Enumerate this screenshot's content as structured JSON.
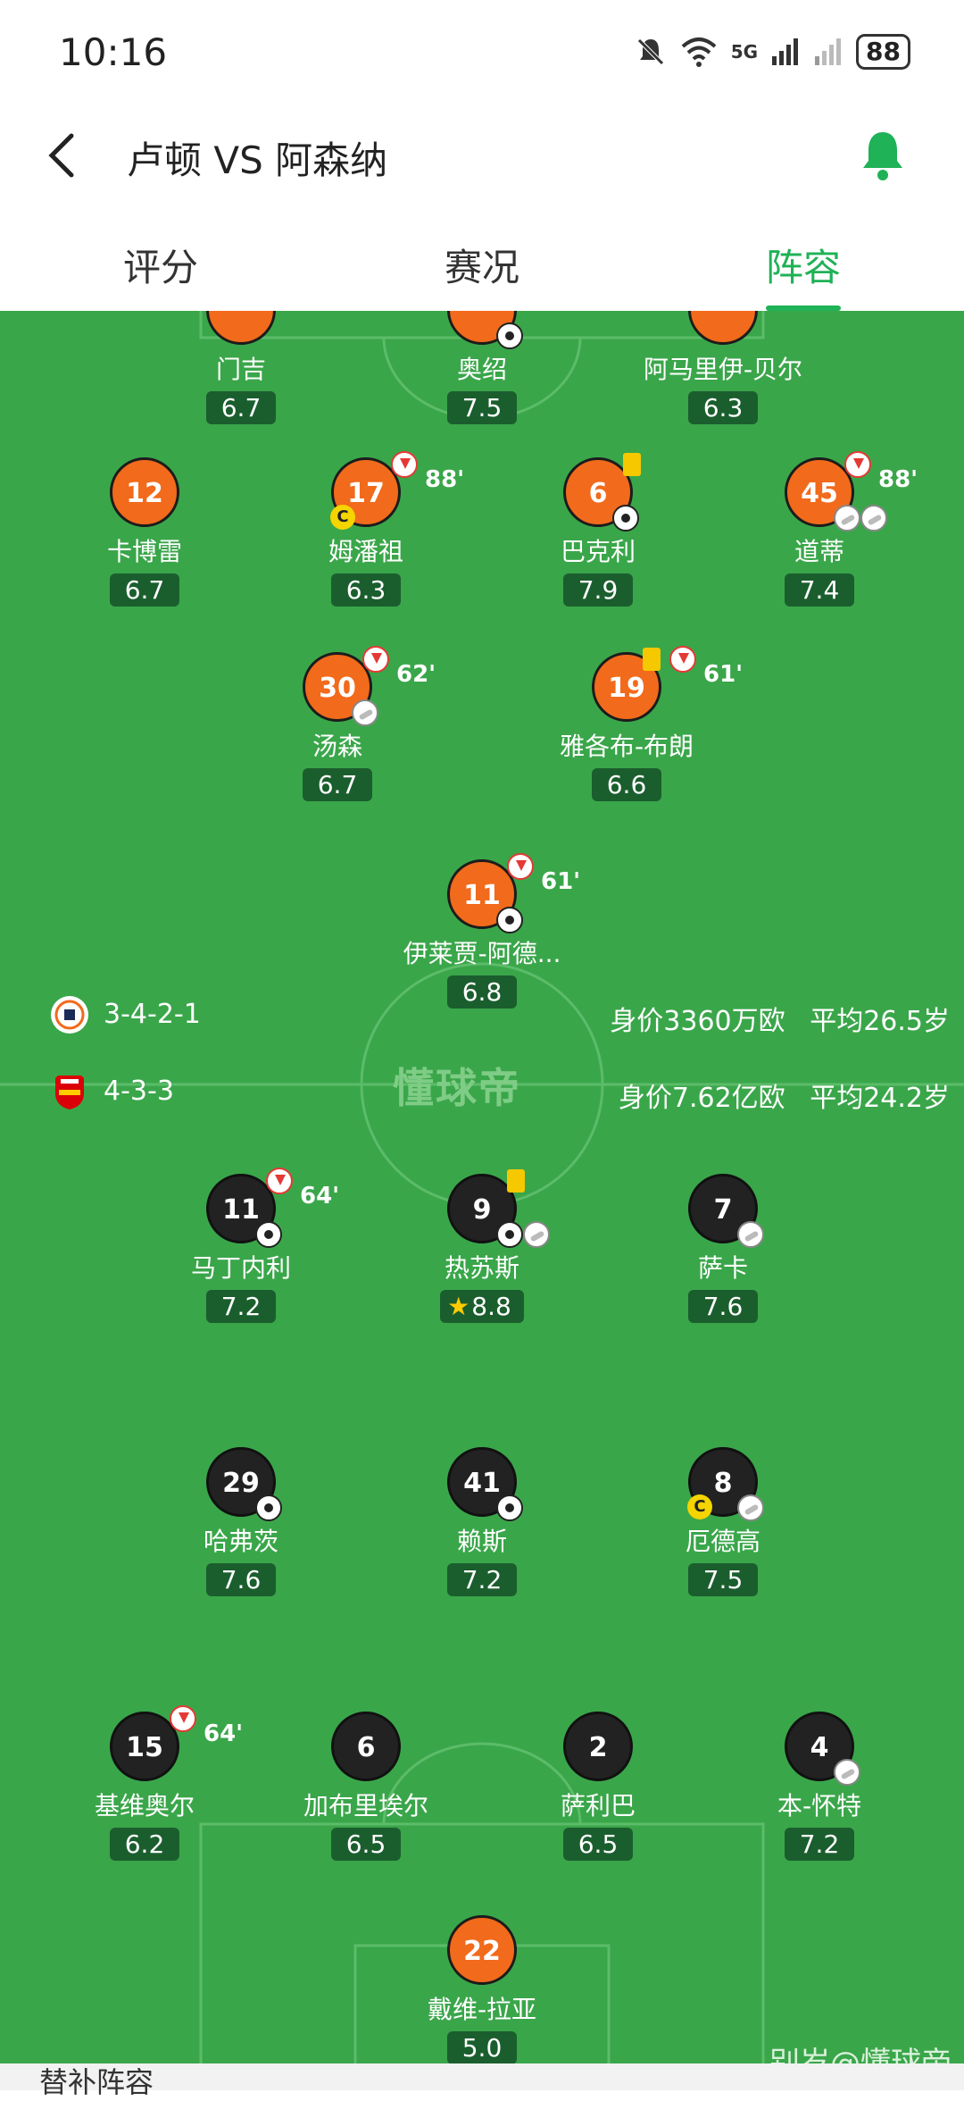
{
  "status_bar": {
    "time": "10:16",
    "battery": "88",
    "network": "5G"
  },
  "header": {
    "title": "卢顿 VS 阿森纳",
    "back_icon": "chevron-left-icon",
    "bell_icon": "bell-icon",
    "bell_color": "#1fb256"
  },
  "tabs": [
    {
      "label": "评分"
    },
    {
      "label": "赛况"
    },
    {
      "label": "阵容",
      "active": true
    }
  ],
  "colors": {
    "pitch": "#3aa64a",
    "home": "#f26a1b",
    "away": "#222222",
    "rating_bg": "#1b5e2e",
    "accent": "#1fb256"
  },
  "home_team": {
    "formation": "3-4-2-1",
    "value": "身价3360万欧",
    "avg_age": "平均26.5岁"
  },
  "away_team": {
    "formation": "4-3-3",
    "value": "身价7.62亿欧",
    "avg_age": "平均24.2岁"
  },
  "home_players": [
    {
      "number": "",
      "name": "门吉",
      "rating": "6.7"
    },
    {
      "number": "",
      "name": "奥绍",
      "rating": "7.5",
      "goal": true
    },
    {
      "number": "",
      "name": "阿马里伊-贝尔",
      "rating": "6.3"
    },
    {
      "number": "12",
      "name": "卡博雷",
      "rating": "6.7"
    },
    {
      "number": "17",
      "name": "姆潘祖",
      "rating": "6.3",
      "sub_min": "88'",
      "captain": "C"
    },
    {
      "number": "6",
      "name": "巴克利",
      "rating": "7.9",
      "yellow": true,
      "goal": true
    },
    {
      "number": "45",
      "name": "道蒂",
      "rating": "7.4",
      "sub_min": "88'",
      "assists": 2
    },
    {
      "number": "30",
      "name": "汤森",
      "rating": "6.7",
      "sub_min": "62'",
      "assist": true
    },
    {
      "number": "19",
      "name": "雅各布-布朗",
      "rating": "6.6",
      "sub_min": "61'",
      "yellow": true
    },
    {
      "number": "11",
      "name": "伊莱贾-阿德...",
      "rating": "6.8",
      "sub_min": "61'",
      "goal": true
    }
  ],
  "away_players": [
    {
      "number": "11",
      "name": "马丁内利",
      "rating": "7.2",
      "sub_min": "64'",
      "goal": true
    },
    {
      "number": "9",
      "name": "热苏斯",
      "rating": "8.8",
      "yellow": true,
      "goal": true,
      "assist": true,
      "mvp": true
    },
    {
      "number": "7",
      "name": "萨卡",
      "rating": "7.6",
      "assist": true
    },
    {
      "number": "29",
      "name": "哈弗茨",
      "rating": "7.6",
      "goal": true
    },
    {
      "number": "41",
      "name": "赖斯",
      "rating": "7.2",
      "goal": true
    },
    {
      "number": "8",
      "name": "厄德高",
      "rating": "7.5",
      "assist": true,
      "captain": "C"
    },
    {
      "number": "15",
      "name": "基维奥尔",
      "rating": "6.2",
      "sub_min": "64'"
    },
    {
      "number": "6",
      "name": "加布里埃尔",
      "rating": "6.5"
    },
    {
      "number": "2",
      "name": "萨利巴",
      "rating": "6.5"
    },
    {
      "number": "4",
      "name": "本-怀特",
      "rating": "7.2",
      "assist": true
    },
    {
      "number": "22",
      "name": "戴维-拉亚",
      "rating": "5.0"
    }
  ],
  "watermark": {
    "center": "懂球帝",
    "corner": "别岁@懂球帝"
  },
  "bottom": {
    "label": "替补阵容"
  }
}
